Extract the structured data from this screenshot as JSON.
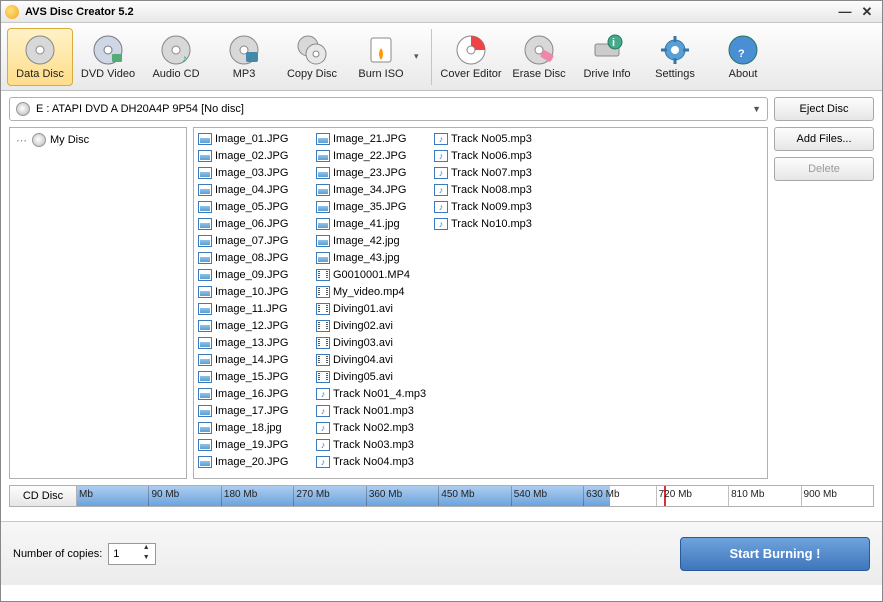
{
  "window": {
    "title": "AVS Disc Creator 5.2"
  },
  "toolbar": {
    "data_disc": "Data Disc",
    "dvd_video": "DVD Video",
    "audio_cd": "Audio CD",
    "mp3": "MP3",
    "copy_disc": "Copy Disc",
    "burn_iso": "Burn ISO",
    "cover_editor": "Cover Editor",
    "erase_disc": "Erase Disc",
    "drive_info": "Drive Info",
    "settings": "Settings",
    "about": "About"
  },
  "drive": {
    "text": "E : ATAPI   DVD A  DH20A4P   9P54        [No disc]"
  },
  "buttons": {
    "eject": "Eject Disc",
    "add_files": "Add Files...",
    "delete": "Delete",
    "cd_disc": "CD Disc",
    "start_burning": "Start Burning !"
  },
  "tree": {
    "root": "My Disc"
  },
  "files": [
    {
      "n": "Image_01.JPG",
      "t": "img"
    },
    {
      "n": "Image_02.JPG",
      "t": "img"
    },
    {
      "n": "Image_03.JPG",
      "t": "img"
    },
    {
      "n": "Image_04.JPG",
      "t": "img"
    },
    {
      "n": "Image_05.JPG",
      "t": "img"
    },
    {
      "n": "Image_06.JPG",
      "t": "img"
    },
    {
      "n": "Image_07.JPG",
      "t": "img"
    },
    {
      "n": "Image_08.JPG",
      "t": "img"
    },
    {
      "n": "Image_09.JPG",
      "t": "img"
    },
    {
      "n": "Image_10.JPG",
      "t": "img"
    },
    {
      "n": "Image_11.JPG",
      "t": "img"
    },
    {
      "n": "Image_12.JPG",
      "t": "img"
    },
    {
      "n": "Image_13.JPG",
      "t": "img"
    },
    {
      "n": "Image_14.JPG",
      "t": "img"
    },
    {
      "n": "Image_15.JPG",
      "t": "img"
    },
    {
      "n": "Image_16.JPG",
      "t": "img"
    },
    {
      "n": "Image_17.JPG",
      "t": "img"
    },
    {
      "n": "Image_18.jpg",
      "t": "img"
    },
    {
      "n": "Image_19.JPG",
      "t": "img"
    },
    {
      "n": "Image_20.JPG",
      "t": "img"
    },
    {
      "n": "Image_21.JPG",
      "t": "img"
    },
    {
      "n": "Image_22.JPG",
      "t": "img"
    },
    {
      "n": "Image_23.JPG",
      "t": "img"
    },
    {
      "n": "Image_34.JPG",
      "t": "img"
    },
    {
      "n": "Image_35.JPG",
      "t": "img"
    },
    {
      "n": "Image_41.jpg",
      "t": "img"
    },
    {
      "n": "Image_42.jpg",
      "t": "img"
    },
    {
      "n": "Image_43.jpg",
      "t": "img"
    },
    {
      "n": "G0010001.MP4",
      "t": "vid"
    },
    {
      "n": "My_video.mp4",
      "t": "vid"
    },
    {
      "n": "Diving01.avi",
      "t": "vid"
    },
    {
      "n": "Diving02.avi",
      "t": "vid"
    },
    {
      "n": "Diving03.avi",
      "t": "vid"
    },
    {
      "n": "Diving04.avi",
      "t": "vid"
    },
    {
      "n": "Diving05.avi",
      "t": "vid"
    },
    {
      "n": "Track No01_4.mp3",
      "t": "aud"
    },
    {
      "n": "Track No01.mp3",
      "t": "aud"
    },
    {
      "n": "Track No02.mp3",
      "t": "aud"
    },
    {
      "n": "Track No03.mp3",
      "t": "aud"
    },
    {
      "n": "Track No04.mp3",
      "t": "aud"
    },
    {
      "n": "Track No05.mp3",
      "t": "aud"
    },
    {
      "n": "Track No06.mp3",
      "t": "aud"
    },
    {
      "n": "Track No07.mp3",
      "t": "aud"
    },
    {
      "n": "Track No08.mp3",
      "t": "aud"
    },
    {
      "n": "Track No09.mp3",
      "t": "aud"
    },
    {
      "n": "Track No10.mp3",
      "t": "aud"
    }
  ],
  "ruler": {
    "labels": [
      "Mb",
      "90 Mb",
      "180 Mb",
      "270 Mb",
      "360 Mb",
      "450 Mb",
      "540 Mb",
      "630 Mb",
      "720 Mb",
      "810 Mb",
      "900 Mb"
    ]
  },
  "footer": {
    "copies_label": "Number of copies:",
    "copies_value": "1"
  }
}
